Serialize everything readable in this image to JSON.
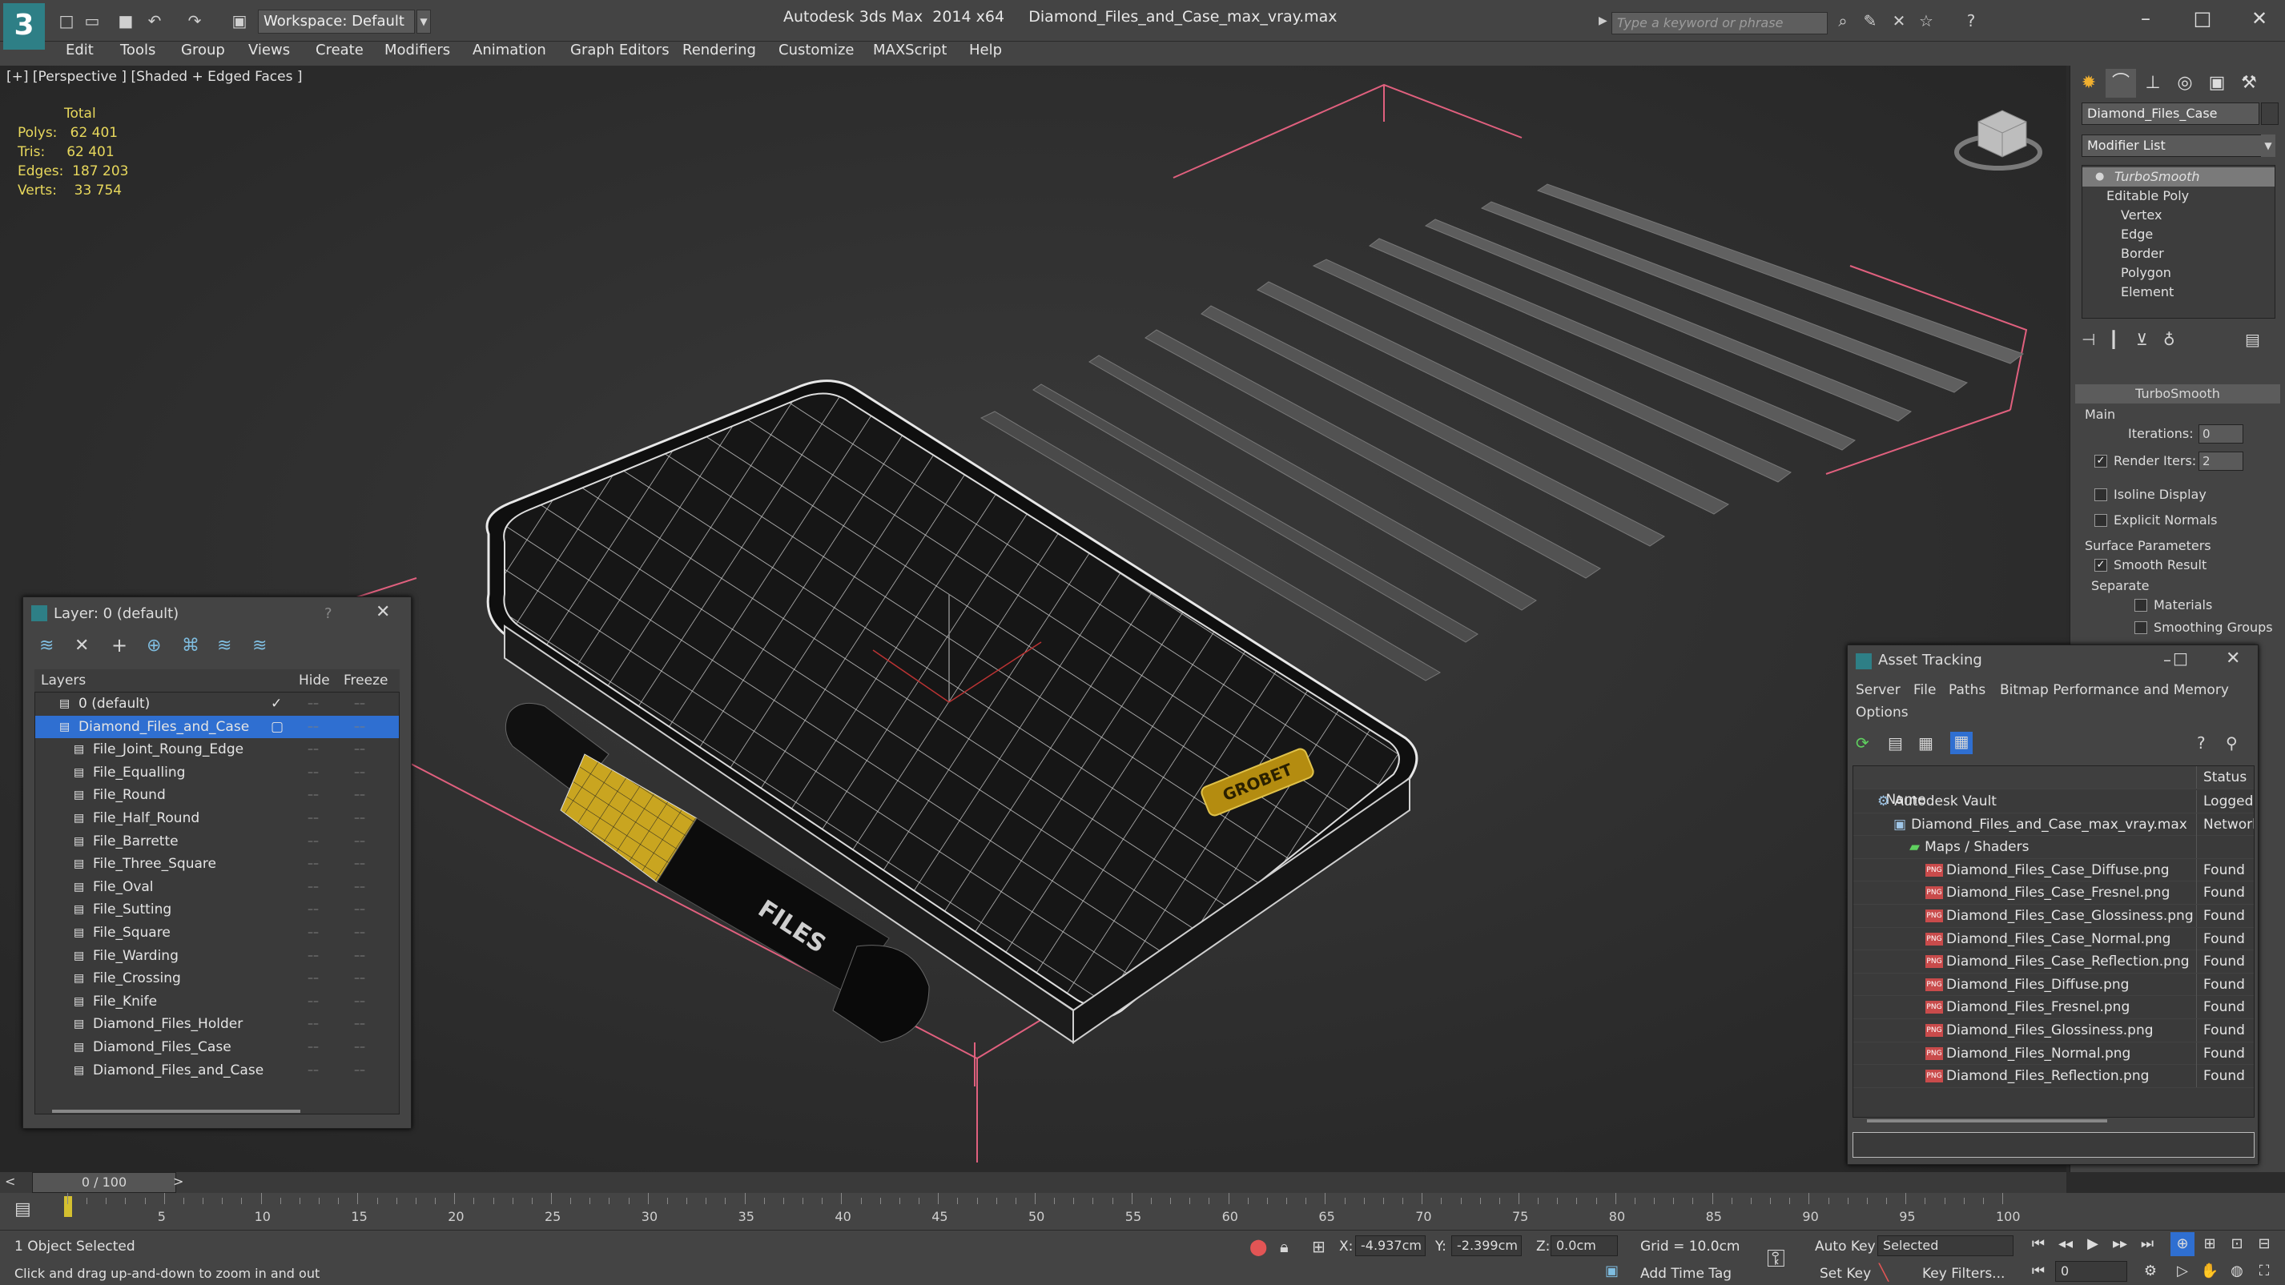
{
  "app": {
    "title": "Autodesk 3ds Max  2014 x64     Diamond_Files_and_Case_max_vray.max",
    "workspace": "Workspace: Default",
    "search_placeholder": "Type a keyword or phrase"
  },
  "menu": [
    "Edit",
    "Tools",
    "Group",
    "Views",
    "Create",
    "Modifiers",
    "Animation",
    "Graph Editors",
    "Rendering",
    "Customize",
    "MAXScript",
    "Help"
  ],
  "viewport": {
    "label": "[+] [Perspective ] [Shaded + Edged Faces ]",
    "stats": {
      "total_label": "Total",
      "polys": "Polys:   62 401",
      "tris": "Tris:     62 401",
      "edges": "Edges:  187 203",
      "verts": "Verts:    33 754"
    },
    "brand_plate": "GROBET",
    "handle_label": "FILES"
  },
  "command_panel": {
    "object_name": "Diamond_Files_Case",
    "modifier_list": "Modifier List",
    "stack": [
      "TurboSmooth",
      "Editable Poly",
      "Vertex",
      "Edge",
      "Border",
      "Polygon",
      "Element"
    ],
    "rollout_title": "TurboSmooth",
    "main_label": "Main",
    "iterations_label": "Iterations:",
    "iterations_value": "0",
    "render_iters_label": "Render Iters:",
    "render_iters_value": "2",
    "isoline_label": "Isoline Display",
    "explicit_normals_label": "Explicit Normals",
    "surface_params_label": "Surface Parameters",
    "smooth_result_label": "Smooth Result",
    "separate_label": "Separate",
    "materials_label": "Materials",
    "smoothing_groups_label": "Smoothing Groups"
  },
  "layer_dialog": {
    "title": "Layer: 0 (default)",
    "help": "?",
    "col_layers": "Layers",
    "col_hide": "Hide",
    "col_freeze": "Freeze",
    "rows": [
      {
        "name": "0 (default)",
        "indent": 0
      },
      {
        "name": "Diamond_Files_and_Case",
        "indent": 0,
        "selected": true
      },
      {
        "name": "File_Joint_Roung_Edge",
        "indent": 1
      },
      {
        "name": "File_Equalling",
        "indent": 1
      },
      {
        "name": "File_Round",
        "indent": 1
      },
      {
        "name": "File_Half_Round",
        "indent": 1
      },
      {
        "name": "File_Barrette",
        "indent": 1
      },
      {
        "name": "File_Three_Square",
        "indent": 1
      },
      {
        "name": "File_Oval",
        "indent": 1
      },
      {
        "name": "File_Sutting",
        "indent": 1
      },
      {
        "name": "File_Square",
        "indent": 1
      },
      {
        "name": "File_Warding",
        "indent": 1
      },
      {
        "name": "File_Crossing",
        "indent": 1
      },
      {
        "name": "File_Knife",
        "indent": 1
      },
      {
        "name": "Diamond_Files_Holder",
        "indent": 1
      },
      {
        "name": "Diamond_Files_Case",
        "indent": 1
      },
      {
        "name": "Diamond_Files_and_Case",
        "indent": 1
      }
    ]
  },
  "asset_tracking": {
    "title": "Asset Tracking",
    "menu": [
      "Server",
      "File",
      "Paths",
      "Bitmap Performance and Memory",
      "Options"
    ],
    "col_name": "Name",
    "col_status": "Status",
    "rows": [
      {
        "name": "Autodesk Vault",
        "status": "Logged",
        "indent": 0,
        "kind": "vault"
      },
      {
        "name": "Diamond_Files_and_Case_max_vray.max",
        "status": "Network",
        "indent": 1,
        "kind": "max"
      },
      {
        "name": "Maps / Shaders",
        "status": "",
        "indent": 2,
        "kind": "folder"
      },
      {
        "name": "Diamond_Files_Case_Diffuse.png",
        "status": "Found",
        "indent": 3,
        "kind": "png"
      },
      {
        "name": "Diamond_Files_Case_Fresnel.png",
        "status": "Found",
        "indent": 3,
        "kind": "png"
      },
      {
        "name": "Diamond_Files_Case_Glossiness.png",
        "status": "Found",
        "indent": 3,
        "kind": "png"
      },
      {
        "name": "Diamond_Files_Case_Normal.png",
        "status": "Found",
        "indent": 3,
        "kind": "png"
      },
      {
        "name": "Diamond_Files_Case_Reflection.png",
        "status": "Found",
        "indent": 3,
        "kind": "png"
      },
      {
        "name": "Diamond_Files_Diffuse.png",
        "status": "Found",
        "indent": 3,
        "kind": "png"
      },
      {
        "name": "Diamond_Files_Fresnel.png",
        "status": "Found",
        "indent": 3,
        "kind": "png"
      },
      {
        "name": "Diamond_Files_Glossiness.png",
        "status": "Found",
        "indent": 3,
        "kind": "png"
      },
      {
        "name": "Diamond_Files_Normal.png",
        "status": "Found",
        "indent": 3,
        "kind": "png"
      },
      {
        "name": "Diamond_Files_Reflection.png",
        "status": "Found",
        "indent": 3,
        "kind": "png"
      }
    ],
    "png_badge": "PNG"
  },
  "timeline": {
    "frame_counter": "0 / 100",
    "ticks": [
      "5",
      "10",
      "15",
      "20",
      "25",
      "30",
      "35",
      "40",
      "45",
      "50",
      "55",
      "60",
      "65",
      "70",
      "75",
      "80",
      "85",
      "90",
      "95",
      "100"
    ]
  },
  "status": {
    "selection": "1 Object Selected",
    "prompt": "Click and drag up-and-down to zoom in and out",
    "x_label": "X:",
    "x_value": "-4.937cm",
    "y_label": "Y:",
    "y_value": "-2.399cm",
    "z_label": "Z:",
    "z_value": "0.0cm",
    "grid": "Grid = 10.0cm",
    "auto_key": "Auto Key",
    "set_key": "Set Key",
    "selected_dropdown": "Selected",
    "key_filters": "Key Filters...",
    "add_time_tag": "Add Time Tag",
    "frame_value": "0"
  },
  "colors": {
    "accent": "#2e7f86",
    "selection_blue": "#2f6fd1",
    "stats_yellow": "#e8d85c",
    "bounding_pink": "#e0607e"
  }
}
